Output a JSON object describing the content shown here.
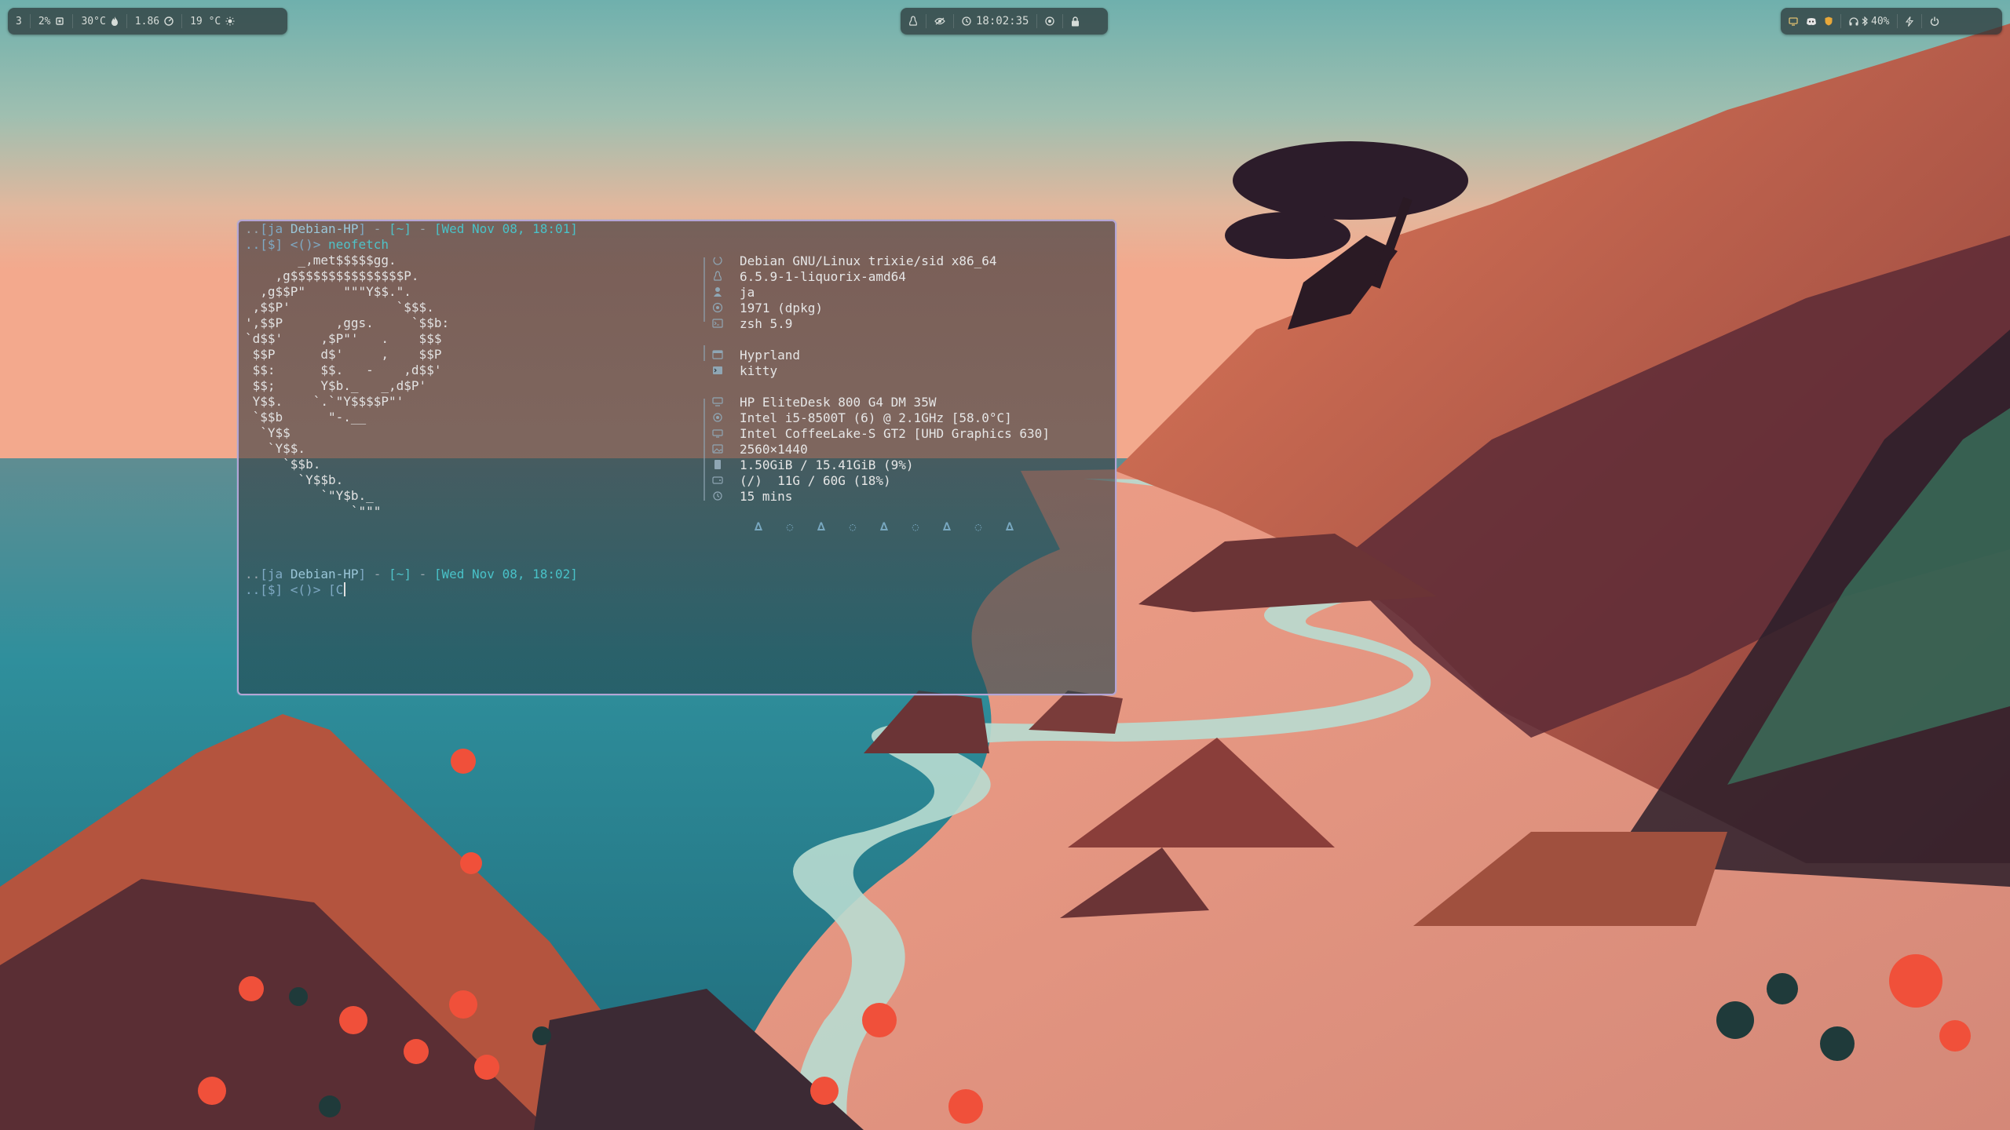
{
  "topbar_left": {
    "workspace": "3",
    "cpu": "2%",
    "cpu_icon": "cpu-icon",
    "temp": "30°C",
    "temp_icon": "flame-icon",
    "load": "1.86",
    "load_icon": "gauge-icon",
    "weather": "19 °C",
    "weather_icon": "sun-icon"
  },
  "topbar_center": {
    "arch_icon": "linux-icon",
    "idle_icon": "eye-icon",
    "clock_icon": "clock-icon",
    "time": "18:02:35",
    "record_icon": "record-icon",
    "lock_icon": "lock-icon"
  },
  "topbar_right": {
    "tray_icons": [
      "monitor-icon",
      "discord-icon",
      "shield-icon"
    ],
    "volume": "40%",
    "volume_icons": [
      "headphones-icon",
      "bluetooth-icon"
    ],
    "battery_icon": "battery-bolt-icon",
    "power_icon": "power-icon"
  },
  "terminal": {
    "border_color": "#b4a4d6",
    "prompt1": {
      "prefix": "..",
      "user": "ja",
      "host": "Debian-HP",
      "dash": " - ",
      "path": "[~]",
      "date": "[Wed Nov 08, 18:01]",
      "symbol": "..[$] <()>",
      "command": "neofetch"
    },
    "neofetch": {
      "logo": [
        "       _,met$$$$$gg.",
        "    ,g$$$$$$$$$$$$$$$P.",
        "  ,g$$P\"     \"\"\"Y$$.\".",
        " ,$$P'              `$$$.",
        "',$$P       ,ggs.     `$$b:",
        "`d$$'     ,$P\"'   .    $$$",
        " $$P      d$'     ,    $$P",
        " $$:      $$.   -    ,d$$'",
        " $$;      Y$b._   _,d$P'",
        " Y$$.    `.`\"Y$$$$P\"'",
        " `$$b      \"-.__",
        "  `Y$$",
        "   `Y$$.",
        "     `$$b.",
        "       `Y$$b.",
        "          `\"Y$b._",
        "              `\"\"\""
      ],
      "os": "Debian GNU/Linux trixie/sid x86_64",
      "kernel": "6.5.9-1-liquorix-amd64",
      "user": "ja",
      "packages": "1971 (dpkg)",
      "shell": "zsh 5.9",
      "wm": "Hyprland",
      "terminal": "kitty",
      "host": "HP EliteDesk 800 G4 DM 35W",
      "cpu": "Intel i5-8500T (6) @ 2.1GHz [58.0°C]",
      "gpu": "Intel CoffeeLake-S GT2 [UHD Graphics 630]",
      "resolution": "2560×1440",
      "memory": "1.50GiB / 15.41GiB (9%)",
      "disk": "(/)  11G / 60G (18%)",
      "uptime": "15 mins",
      "palette": [
        "linux-icon",
        "debian-swirl-icon",
        "linux-icon",
        "debian-swirl-icon",
        "linux-icon",
        "debian-swirl-icon",
        "linux-icon",
        "debian-swirl-icon",
        "linux-icon"
      ]
    },
    "prompt2": {
      "prefix": "..",
      "user": "ja",
      "host": "Debian-HP",
      "dash": " - ",
      "path": "[~]",
      "date": "[Wed Nov 08, 18:02]",
      "symbol": "..[$] <()>",
      "typed": "[C"
    }
  }
}
